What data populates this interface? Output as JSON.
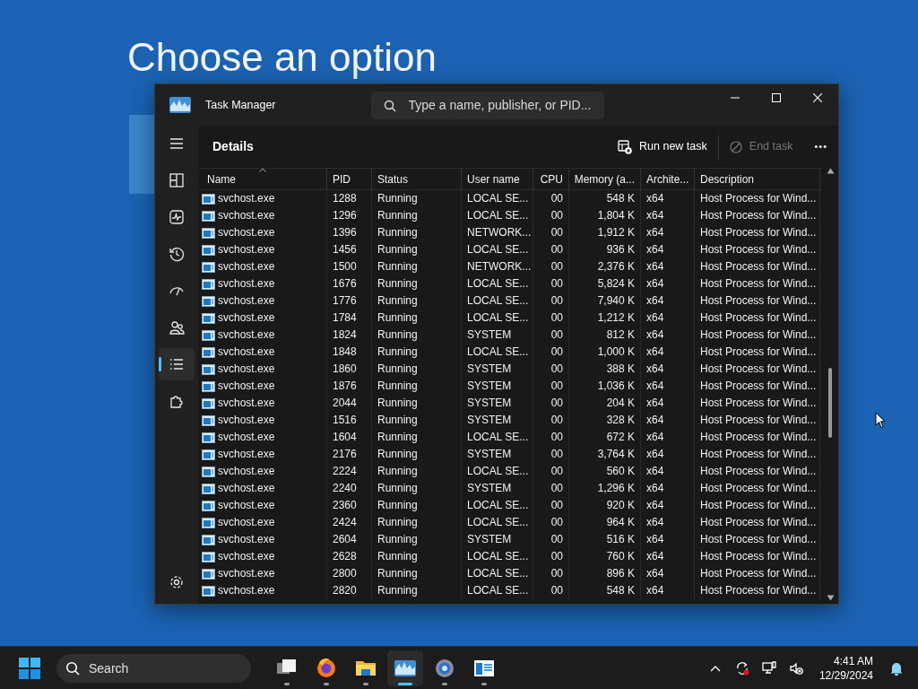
{
  "desktop": {
    "heading": "Choose an option"
  },
  "window": {
    "title": "Task Manager",
    "search": {
      "placeholder": "Type a name, publisher, or PID..."
    },
    "sidebar": [
      {
        "kind": "menu",
        "selected": false
      },
      {
        "kind": "processes",
        "selected": false
      },
      {
        "kind": "performance",
        "selected": false
      },
      {
        "kind": "history",
        "selected": false
      },
      {
        "kind": "startup",
        "selected": false
      },
      {
        "kind": "users",
        "selected": false
      },
      {
        "kind": "details",
        "selected": true
      },
      {
        "kind": "services",
        "selected": false
      },
      {
        "kind": "settings",
        "selected": false
      }
    ],
    "page_title": "Details",
    "toolbar": [
      {
        "kind": "run",
        "label": "Run new task",
        "disabled": false
      },
      {
        "kind": "end",
        "label": "End task",
        "disabled": true
      },
      {
        "kind": "more",
        "label": "•••",
        "disabled": false
      }
    ],
    "columns": [
      {
        "label": "Name",
        "sorted": true
      },
      {
        "label": "PID",
        "sorted": false
      },
      {
        "label": "Status",
        "sorted": false
      },
      {
        "label": "User name",
        "sorted": false
      },
      {
        "label": "CPU",
        "sorted": false
      },
      {
        "label": "Memory (a...",
        "sorted": false
      },
      {
        "label": "Archite...",
        "sorted": false
      },
      {
        "label": "Description",
        "sorted": false
      }
    ],
    "rows": [
      [
        "svchost.exe",
        "1288",
        "Running",
        "LOCAL SE...",
        "00",
        "548 K",
        "x64",
        "Host Process for Wind..."
      ],
      [
        "svchost.exe",
        "1296",
        "Running",
        "LOCAL SE...",
        "00",
        "1,804 K",
        "x64",
        "Host Process for Wind..."
      ],
      [
        "svchost.exe",
        "1396",
        "Running",
        "NETWORK...",
        "00",
        "1,912 K",
        "x64",
        "Host Process for Wind..."
      ],
      [
        "svchost.exe",
        "1456",
        "Running",
        "LOCAL SE...",
        "00",
        "936 K",
        "x64",
        "Host Process for Wind..."
      ],
      [
        "svchost.exe",
        "1500",
        "Running",
        "NETWORK...",
        "00",
        "2,376 K",
        "x64",
        "Host Process for Wind..."
      ],
      [
        "svchost.exe",
        "1676",
        "Running",
        "LOCAL SE...",
        "00",
        "5,824 K",
        "x64",
        "Host Process for Wind..."
      ],
      [
        "svchost.exe",
        "1776",
        "Running",
        "LOCAL SE...",
        "00",
        "7,940 K",
        "x64",
        "Host Process for Wind..."
      ],
      [
        "svchost.exe",
        "1784",
        "Running",
        "LOCAL SE...",
        "00",
        "1,212 K",
        "x64",
        "Host Process for Wind..."
      ],
      [
        "svchost.exe",
        "1824",
        "Running",
        "SYSTEM",
        "00",
        "812 K",
        "x64",
        "Host Process for Wind..."
      ],
      [
        "svchost.exe",
        "1848",
        "Running",
        "LOCAL SE...",
        "00",
        "1,000 K",
        "x64",
        "Host Process for Wind..."
      ],
      [
        "svchost.exe",
        "1860",
        "Running",
        "SYSTEM",
        "00",
        "388 K",
        "x64",
        "Host Process for Wind..."
      ],
      [
        "svchost.exe",
        "1876",
        "Running",
        "SYSTEM",
        "00",
        "1,036 K",
        "x64",
        "Host Process for Wind..."
      ],
      [
        "svchost.exe",
        "2044",
        "Running",
        "SYSTEM",
        "00",
        "204 K",
        "x64",
        "Host Process for Wind..."
      ],
      [
        "svchost.exe",
        "1516",
        "Running",
        "SYSTEM",
        "00",
        "328 K",
        "x64",
        "Host Process for Wind..."
      ],
      [
        "svchost.exe",
        "1604",
        "Running",
        "LOCAL SE...",
        "00",
        "672 K",
        "x64",
        "Host Process for Wind..."
      ],
      [
        "svchost.exe",
        "2176",
        "Running",
        "SYSTEM",
        "00",
        "3,764 K",
        "x64",
        "Host Process for Wind..."
      ],
      [
        "svchost.exe",
        "2224",
        "Running",
        "LOCAL SE...",
        "00",
        "560 K",
        "x64",
        "Host Process for Wind..."
      ],
      [
        "svchost.exe",
        "2240",
        "Running",
        "SYSTEM",
        "00",
        "1,296 K",
        "x64",
        "Host Process for Wind..."
      ],
      [
        "svchost.exe",
        "2360",
        "Running",
        "LOCAL SE...",
        "00",
        "920 K",
        "x64",
        "Host Process for Wind..."
      ],
      [
        "svchost.exe",
        "2424",
        "Running",
        "LOCAL SE...",
        "00",
        "964 K",
        "x64",
        "Host Process for Wind..."
      ],
      [
        "svchost.exe",
        "2604",
        "Running",
        "SYSTEM",
        "00",
        "516 K",
        "x64",
        "Host Process for Wind..."
      ],
      [
        "svchost.exe",
        "2628",
        "Running",
        "LOCAL SE...",
        "00",
        "760 K",
        "x64",
        "Host Process for Wind..."
      ],
      [
        "svchost.exe",
        "2800",
        "Running",
        "LOCAL SE...",
        "00",
        "896 K",
        "x64",
        "Host Process for Wind..."
      ],
      [
        "svchost.exe",
        "2820",
        "Running",
        "LOCAL SE...",
        "00",
        "548 K",
        "x64",
        "Host Process for Wind..."
      ]
    ]
  },
  "taskbar": {
    "search": {
      "placeholder": "Search"
    },
    "apps": [
      {
        "kind": "taskview",
        "selected": false
      },
      {
        "kind": "browser",
        "selected": false
      },
      {
        "kind": "folder",
        "selected": false
      },
      {
        "kind": "taskmanager",
        "selected": true
      },
      {
        "kind": "settings",
        "selected": false
      },
      {
        "kind": "app",
        "selected": false
      }
    ],
    "time": "4:41 AM",
    "date": "12/29/2024"
  }
}
